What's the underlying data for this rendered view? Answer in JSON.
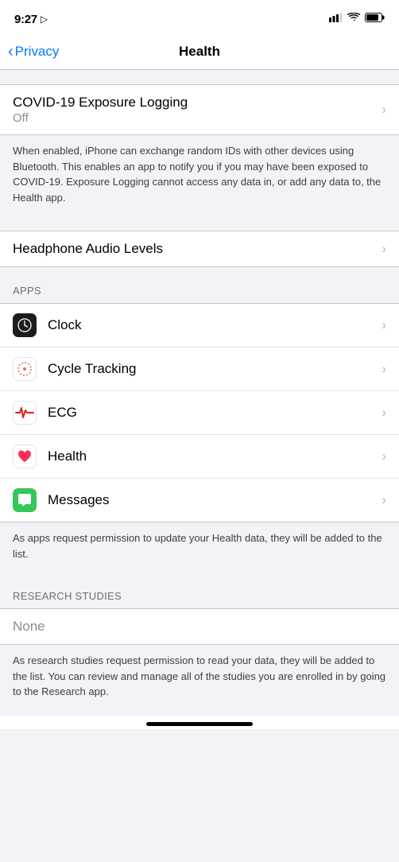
{
  "statusBar": {
    "time": "9:27",
    "locationIcon": "◁",
    "signalBars": "signal-icon",
    "wifiIcon": "wifi-icon",
    "batteryIcon": "battery-icon"
  },
  "navBar": {
    "backLabel": "Privacy",
    "title": "Health"
  },
  "covidSection": {
    "title": "COVID-19 Exposure Logging",
    "subtitle": "Off",
    "description": "When enabled, iPhone can exchange random IDs with other devices using Bluetooth. This enables an app to notify you if you may have been exposed to COVID-19. Exposure Logging cannot access any data in, or add any data to, the Health app."
  },
  "headphoneSection": {
    "title": "Headphone Audio Levels"
  },
  "appsHeader": "APPS",
  "apps": [
    {
      "name": "Clock",
      "icon": "clock"
    },
    {
      "name": "Cycle Tracking",
      "icon": "cycle"
    },
    {
      "name": "ECG",
      "icon": "ecg"
    },
    {
      "name": "Health",
      "icon": "health"
    },
    {
      "name": "Messages",
      "icon": "messages"
    }
  ],
  "appsFooter": "As apps request permission to update your Health data, they will be added to the list.",
  "researchHeader": "RESEARCH STUDIES",
  "researchNone": "None",
  "researchFooter": "As research studies request permission to read your data, they will be added to the list. You can review and manage all of the studies you are enrolled in by going to the Research app."
}
